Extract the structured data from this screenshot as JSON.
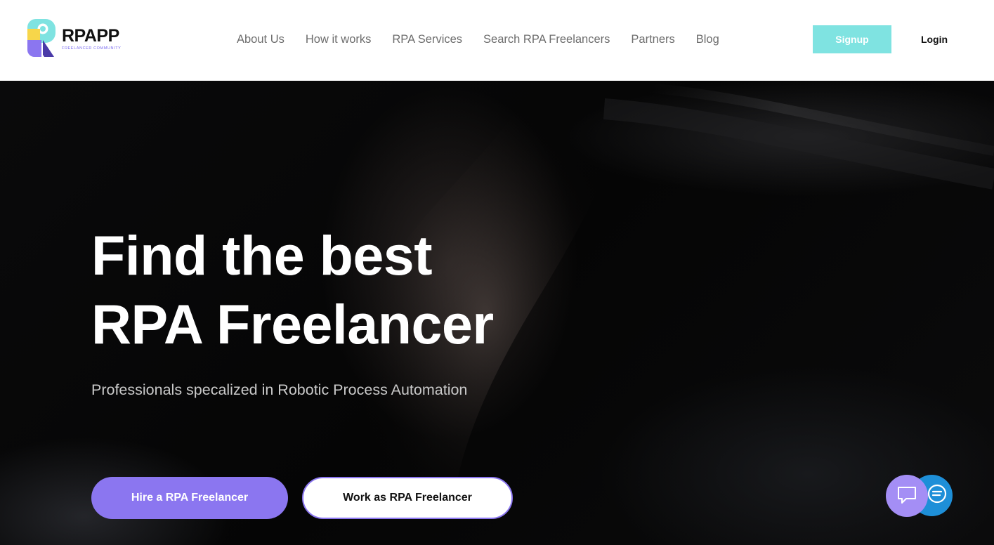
{
  "logo": {
    "wordmark": "RPAPP",
    "tagline": "FREELANCER COMMUNITY",
    "colors": {
      "teal": "#7fe3e1",
      "yellow": "#f7d64a",
      "purple": "#8b76f0",
      "dark_purple": "#4a3aa8"
    }
  },
  "nav": {
    "items": [
      {
        "label": "About Us"
      },
      {
        "label": "How it works"
      },
      {
        "label": "RPA Services"
      },
      {
        "label": "Search RPA Freelancers"
      },
      {
        "label": "Partners"
      },
      {
        "label": "Blog"
      }
    ]
  },
  "auth": {
    "signup_label": "Signup",
    "login_label": "Login"
  },
  "hero": {
    "title_line1": "Find the best",
    "title_line2": "RPA Freelancer",
    "subtitle": "Professionals specalized in Robotic Process Automation",
    "primary_cta": "Hire a RPA Freelancer",
    "secondary_cta": "Work as RPA Freelancer"
  },
  "widgets": {
    "chat_icon": "chat-bubble-icon",
    "messenger_icon": "message-lines-icon"
  },
  "colors": {
    "accent_purple": "#8b76f0",
    "accent_teal": "#7fe3e1",
    "chat_blue": "#1e8fd8",
    "chat_purple": "#a48ef5"
  }
}
